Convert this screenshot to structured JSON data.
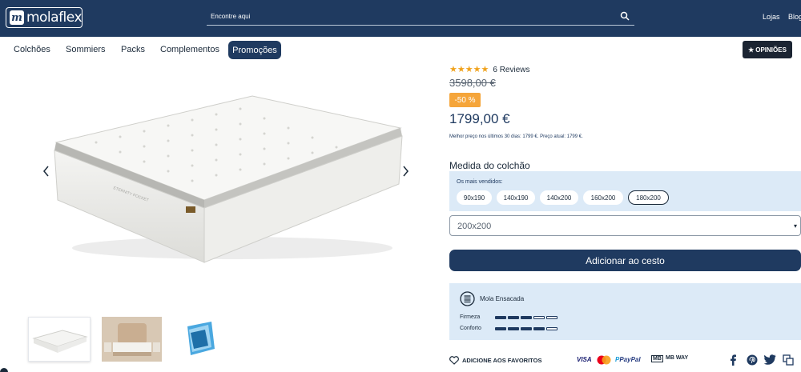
{
  "header": {
    "logo_text": "molaflex",
    "search_placeholder": "Encontre aqui",
    "links": [
      "Lojas",
      "Blog"
    ]
  },
  "nav": {
    "items": [
      "Colchões",
      "Sommiers",
      "Packs",
      "Complementos"
    ],
    "active_item": "Promoções",
    "opinions_label": "OPINIÕES"
  },
  "product": {
    "rating": 5,
    "reviews_label": "6 Reviews",
    "old_price": "3598,00 €",
    "discount": "-50 %",
    "price": "1799,00 €",
    "lowest_price_note": "Melhor preço nos últimos 30 dias: 1799 €. Preço atual: 1799 €.",
    "size_title": "Medida do colchão",
    "best_sellers_label": "Os mais vendidos:",
    "sizes": [
      "90x190",
      "140x190",
      "140x200",
      "160x200",
      "180x200"
    ],
    "selected_size": "180x200",
    "select_value": "200x200",
    "add_to_cart": "Adicionar ao cesto",
    "mattress_label": "ETERNITY POCKET"
  },
  "specs": {
    "type": "Mola Ensacada",
    "rows": [
      {
        "label": "Firmeza",
        "level": 3,
        "max": 5
      },
      {
        "label": "Conforto",
        "level": 4,
        "max": 5
      }
    ]
  },
  "footer": {
    "favorites_label": "ADICIONE AOS FAVORITOS",
    "payments": [
      "VISA",
      "mastercard",
      "PayPal",
      "MB",
      "MB WAY"
    ],
    "social_icons": [
      "facebook-icon",
      "pinterest-icon",
      "twitter-icon",
      "copy-icon"
    ]
  },
  "colors": {
    "navy": "#1f3a60",
    "light_blue": "#dceaf7",
    "discount_orange": "#f5a53a",
    "star": "#f0a21c"
  }
}
